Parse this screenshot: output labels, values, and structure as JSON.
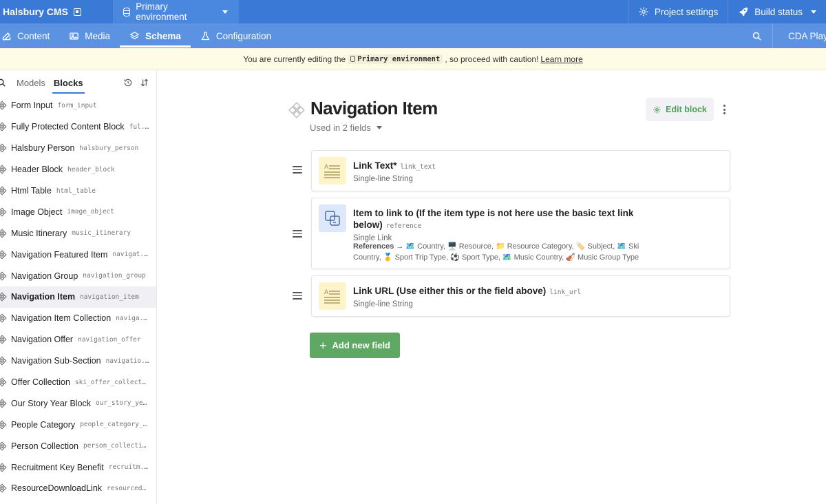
{
  "topbar": {
    "brand": "Halsbury CMS",
    "environment": "Primary environment",
    "project_settings": "Project settings",
    "build_status": "Build status"
  },
  "nav": {
    "tabs": [
      {
        "label": "Content",
        "icon": "edit-icon"
      },
      {
        "label": "Media",
        "icon": "image-icon"
      },
      {
        "label": "Schema",
        "icon": "layers-icon"
      },
      {
        "label": "Configuration",
        "icon": "flask-icon"
      }
    ],
    "active_tab": "Schema",
    "cda_label": "CDA Playground"
  },
  "banner": {
    "prefix": "You are currently editing the",
    "env_code": "Primary environment",
    "suffix": ", so proceed with caution!",
    "learn_more": "Learn more"
  },
  "sidebar": {
    "tabs": [
      "Models",
      "Blocks"
    ],
    "active_tab": "Blocks",
    "items": [
      {
        "label": "Form Input",
        "code": "form_input"
      },
      {
        "label": "Fully Protected Content Block",
        "code": "ful..."
      },
      {
        "label": "Halsbury Person",
        "code": "halsbury_person"
      },
      {
        "label": "Header Block",
        "code": "header_block"
      },
      {
        "label": "Html Table",
        "code": "html_table"
      },
      {
        "label": "Image Object",
        "code": "image_object"
      },
      {
        "label": "Music Itinerary",
        "code": "music_itinerary"
      },
      {
        "label": "Navigation Featured Item",
        "code": "navigat..."
      },
      {
        "label": "Navigation Group",
        "code": "navigation_group"
      },
      {
        "label": "Navigation Item",
        "code": "navigation_item"
      },
      {
        "label": "Navigation Item Collection",
        "code": "naviga..."
      },
      {
        "label": "Navigation Offer",
        "code": "navigation_offer"
      },
      {
        "label": "Navigation Sub-Section",
        "code": "navigatio..."
      },
      {
        "label": "Offer Collection",
        "code": "ski_offer_collect..."
      },
      {
        "label": "Our Story Year Block",
        "code": "our_story_ye..."
      },
      {
        "label": "People Category",
        "code": "people_category_..."
      },
      {
        "label": "Person Collection",
        "code": "person_collection"
      },
      {
        "label": "Recruitment Key Benefit",
        "code": "recruitm..."
      },
      {
        "label": "ResourceDownloadLink",
        "code": "resourced..."
      }
    ],
    "selected_index": 9
  },
  "main": {
    "title": "Navigation Item",
    "used_in": "Used in 2 fields",
    "edit_block": "Edit block",
    "fields": [
      {
        "title": "Link Text*",
        "api_key": "link_text",
        "type": "Single-line String",
        "icon": "text-field-icon"
      },
      {
        "title_line1": "Item to link to (If the item type is not here use the basic text link",
        "title_line2": "below)",
        "api_key": "reference",
        "type": "Single Link",
        "icon": "link-field-icon",
        "refs_label": "References →",
        "refs_line1": " 🗺️ Country, 🖥️ Resource, 📁 Resource Category, 🏷️ Subject, 🗺️ Ski",
        "refs_line2": "Country, 🥇 Sport Trip Type, ⚽ Sport Type, 🗺️ Music Country, 🎻 Music Group Type"
      },
      {
        "title": "Link URL (Use either this or the field above)",
        "api_key": "link_url",
        "type": "Single-line String",
        "icon": "text-field-icon"
      }
    ],
    "add_field": "Add new field"
  },
  "colors": {
    "topbar": "#3a79d6",
    "navbar": "#5b93e2",
    "banner": "#fefbe6",
    "accent_green": "#5ea864"
  }
}
